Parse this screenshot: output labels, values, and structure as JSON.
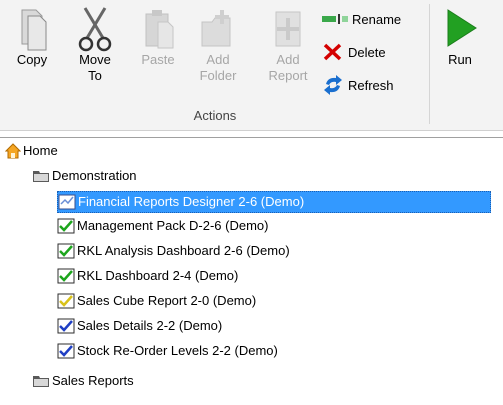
{
  "ribbon": {
    "copy": "Copy",
    "move_to_line1": "Move",
    "move_to_line2": "To",
    "paste": "Paste",
    "add_folder_line1": "Add",
    "add_folder_line2": "Folder",
    "add_report_line1": "Add",
    "add_report_line2": "Report",
    "rename": "Rename",
    "delete": "Delete",
    "refresh": "Refresh",
    "run": "Run",
    "group_label": "Actions"
  },
  "tree": {
    "home": "Home",
    "demonstration": "Demonstration",
    "items": [
      {
        "label": "Financial Reports Designer 2-6 (Demo)",
        "icon": "report-designer-icon"
      },
      {
        "label": "Management Pack D-2-6 (Demo)",
        "icon": "green-check-report-icon"
      },
      {
        "label": "RKL Analysis Dashboard 2-6 (Demo)",
        "icon": "green-check-report-icon"
      },
      {
        "label": "RKL Dashboard 2-4 (Demo)",
        "icon": "green-check-report-icon"
      },
      {
        "label": "Sales Cube Report 2-0 (Demo)",
        "icon": "yellow-check-report-icon"
      },
      {
        "label": "Sales Details 2-2 (Demo)",
        "icon": "blue-check-report-icon"
      },
      {
        "label": "Stock Re-Order Levels 2-2 (Demo)",
        "icon": "blue-check-report-icon"
      }
    ],
    "sales_reports": "Sales Reports",
    "selected_index": 0
  }
}
